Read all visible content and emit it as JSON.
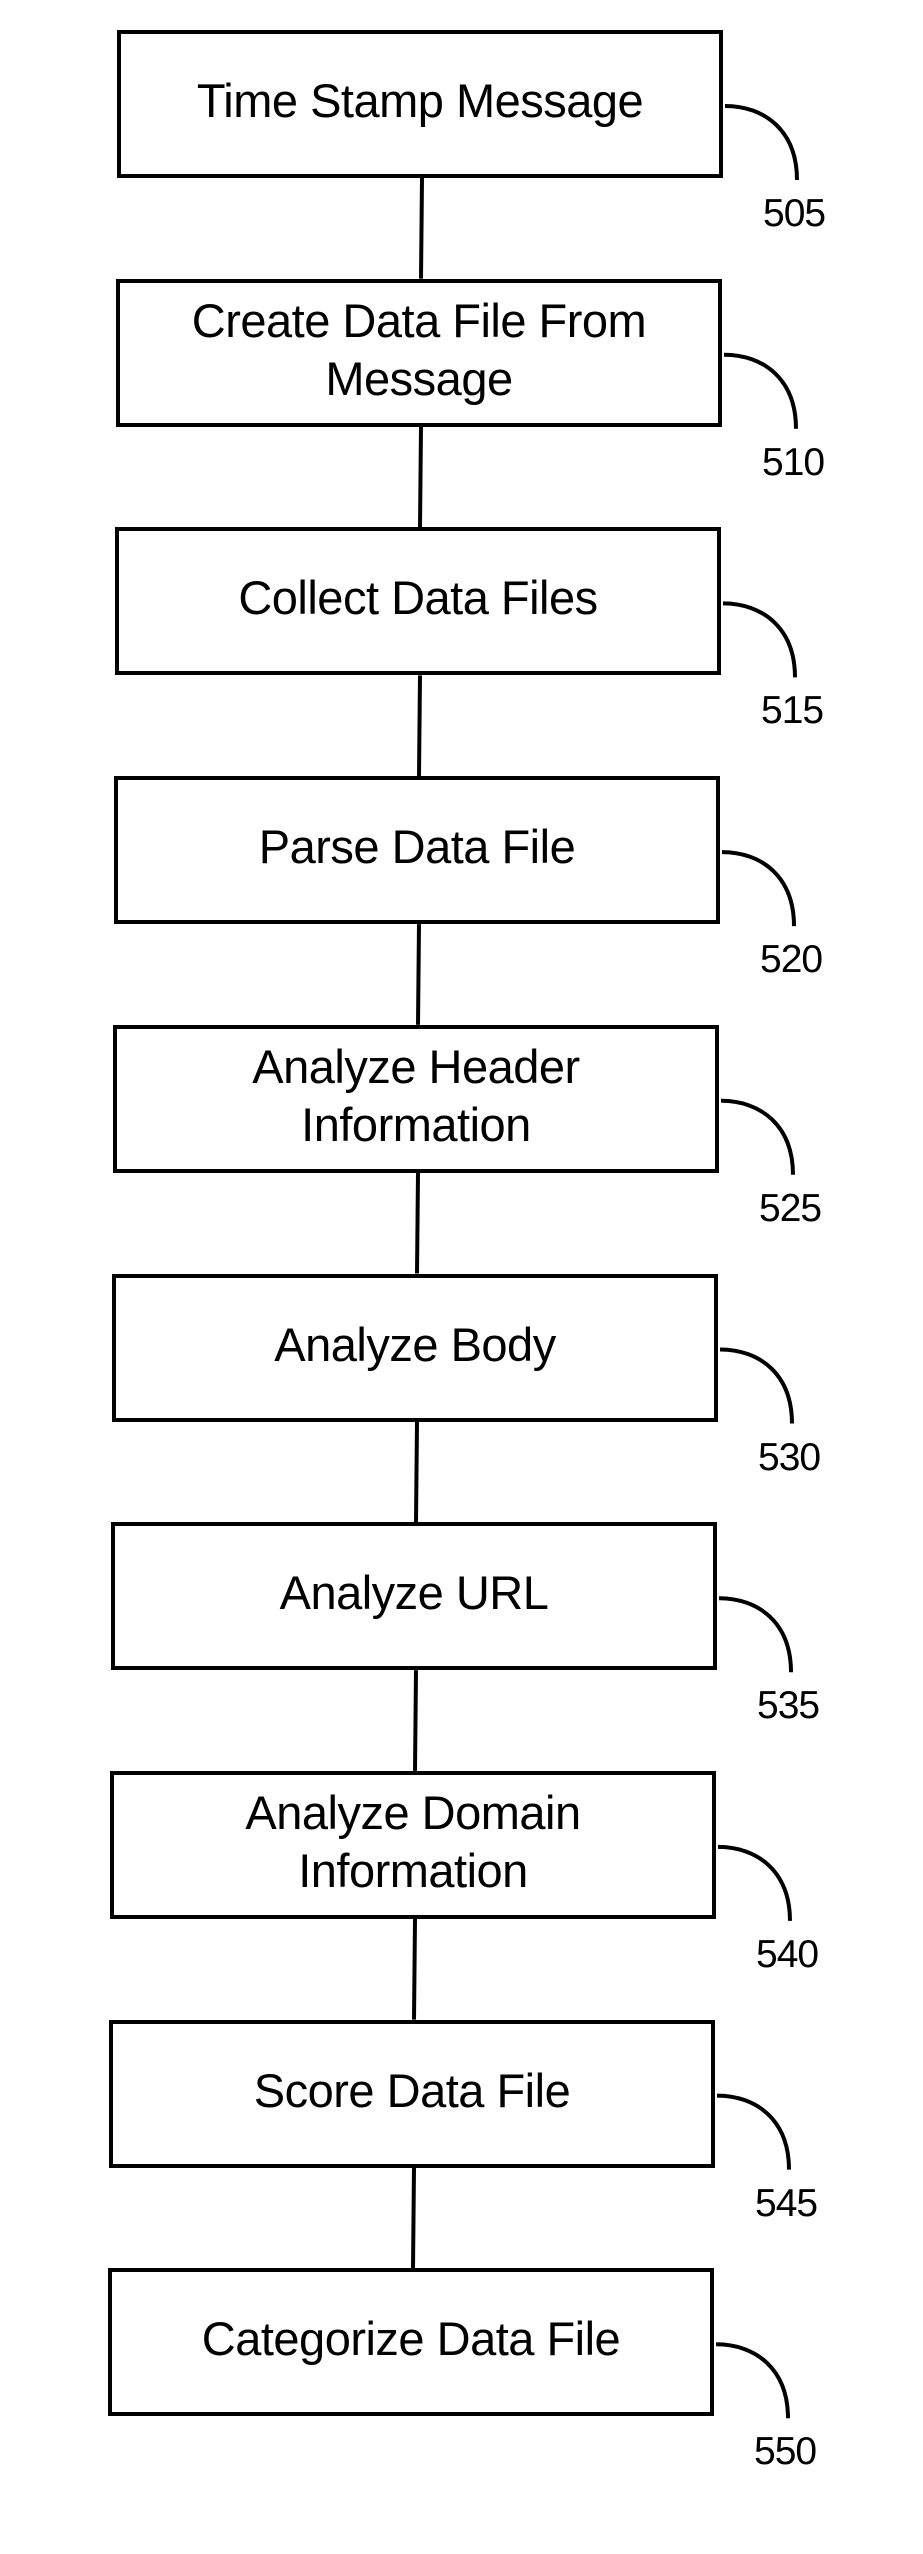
{
  "figure": {
    "type": "flowchart",
    "direction": "top-to-bottom",
    "steps": [
      {
        "label": "Time Stamp Message",
        "ref": "505"
      },
      {
        "label": "Create Data File From\nMessage",
        "ref": "510"
      },
      {
        "label": "Collect Data Files",
        "ref": "515"
      },
      {
        "label": "Parse Data File",
        "ref": "520"
      },
      {
        "label": "Analyze Header\nInformation",
        "ref": "525"
      },
      {
        "label": "Analyze Body",
        "ref": "530"
      },
      {
        "label": "Analyze URL",
        "ref": "535"
      },
      {
        "label": "Analyze Domain\nInformation",
        "ref": "540"
      },
      {
        "label": "Score Data File",
        "ref": "545"
      },
      {
        "label": "Categorize Data File",
        "ref": "550"
      }
    ],
    "colors": {
      "stroke": "#000000",
      "background": "#ffffff",
      "text": "#000000"
    }
  }
}
